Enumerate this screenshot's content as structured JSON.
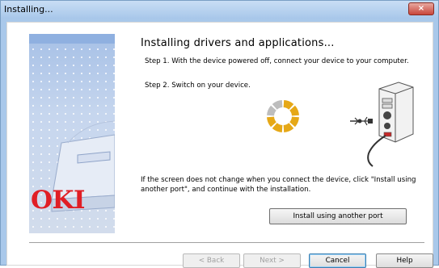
{
  "window": {
    "title": "Installing...",
    "close_label": "×"
  },
  "brand": {
    "logo_text": "OKI"
  },
  "content": {
    "heading": "Installing drivers and applications...",
    "step1": "Step 1. With the device powered off, connect your device to your computer.",
    "step2": "Step 2. Switch on your device.",
    "note": "If the screen does not change when you connect the device, click \"Install using another port\", and continue with the installation.",
    "alt_port_button": "Install using another port"
  },
  "footer": {
    "back_label": "< Back",
    "next_label": "Next >",
    "cancel_label": "Cancel",
    "help_label": "Help"
  },
  "colors": {
    "accent_spinner": "#e6a817",
    "spinner_inactive": "#bdbdbd",
    "brand_red": "#e01e25"
  }
}
